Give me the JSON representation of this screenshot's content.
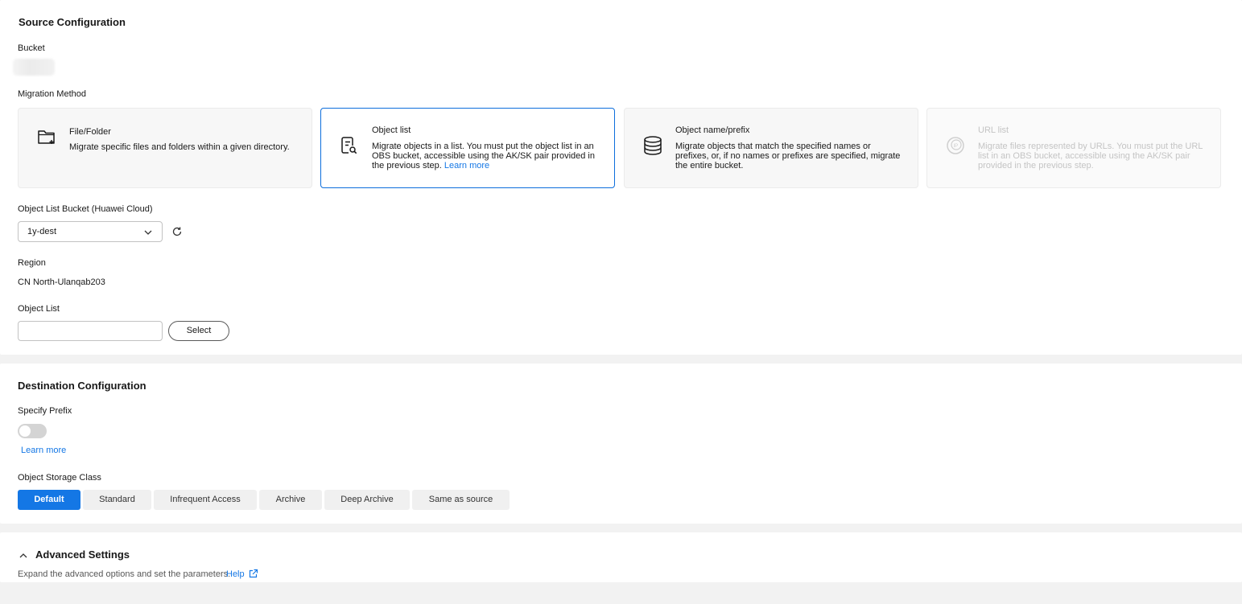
{
  "source": {
    "title": "Source Configuration",
    "bucket_label": "Bucket",
    "migration_method_label": "Migration Method",
    "methods": [
      {
        "icon": "folder-add-icon",
        "title": "File/Folder",
        "desc": "Migrate specific files and folders within a given directory.",
        "state": "normal"
      },
      {
        "icon": "list-search-icon",
        "title": "Object list",
        "desc": "Migrate objects in a list. You must put the object list in an OBS bucket, accessible using the AK/SK pair provided in the previous step.",
        "link": "Learn more",
        "state": "selected"
      },
      {
        "icon": "database-icon",
        "title": "Object name/prefix",
        "desc": "Migrate objects that match the specified names or prefixes, or, if no names or prefixes are specified, migrate the entire bucket.",
        "state": "normal"
      },
      {
        "icon": "ip-globe-icon",
        "title": "URL list",
        "desc": "Migrate files represented by URLs. You must put the URL list in an OBS bucket, accessible using the AK/SK pair provided in the previous step.",
        "state": "disabled"
      }
    ],
    "object_list_bucket_label": "Object List Bucket (Huawei Cloud)",
    "object_list_bucket_value": "1y-dest",
    "region_label": "Region",
    "region_value": "CN North-Ulanqab203",
    "object_list_label": "Object List",
    "object_list_value": "",
    "select_button": "Select"
  },
  "destination": {
    "title": "Destination Configuration",
    "specify_prefix_label": "Specify Prefix",
    "specify_prefix_enabled": false,
    "learn_more": "Learn more",
    "storage_class_label": "Object Storage Class",
    "storage_classes": [
      "Default",
      "Standard",
      "Infrequent Access",
      "Archive",
      "Deep Archive",
      "Same as source"
    ],
    "storage_class_selected": "Default"
  },
  "advanced": {
    "title": "Advanced Settings",
    "desc": "Expand the advanced options and set the parameters.",
    "help": "Help"
  },
  "colors": {
    "accent": "#1477e5",
    "selected_border": "#0d6edc",
    "page_bg": "#f2f2f2"
  }
}
